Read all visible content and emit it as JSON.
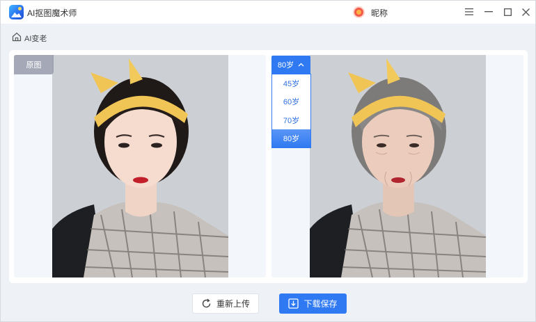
{
  "app": {
    "title": "AI抠图魔术师",
    "user_name": "昵称"
  },
  "breadcrumb": {
    "label": "AI变老"
  },
  "preview": {
    "original_badge": "原图"
  },
  "age_select": {
    "selected": "80岁",
    "options": [
      "45岁",
      "60岁",
      "70岁",
      "80岁"
    ]
  },
  "actions": {
    "reupload_label": "重新上传",
    "save_label": "下载保存"
  },
  "colors": {
    "accent": "#2f7af2",
    "background": "#eef1f6"
  },
  "icons": {
    "window": [
      "menu-icon",
      "minimize-icon",
      "maximize-icon",
      "close-icon"
    ],
    "breadcrumb": "home-icon",
    "reupload": "refresh-icon",
    "save": "download-icon"
  }
}
